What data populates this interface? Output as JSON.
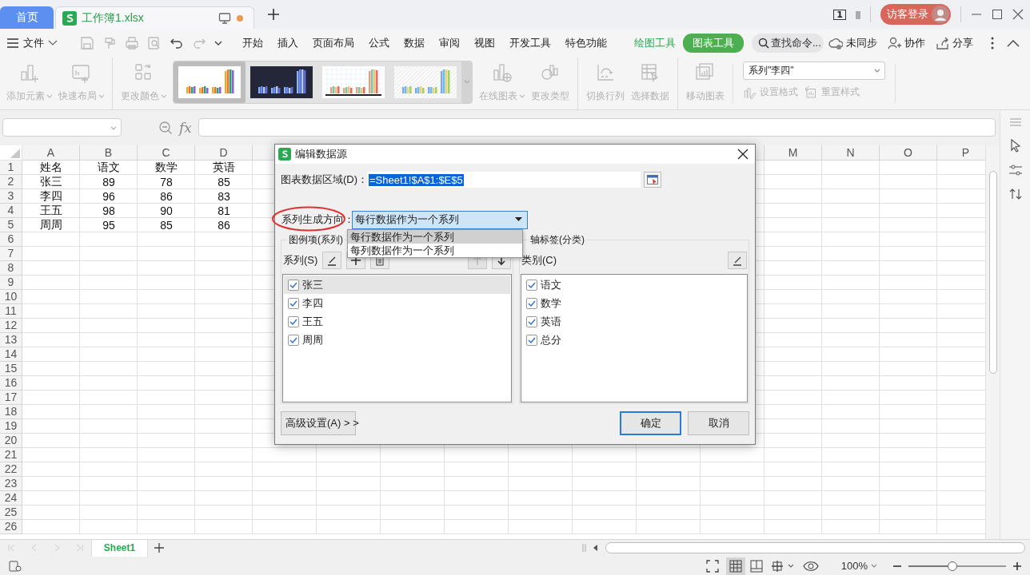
{
  "tabs": [
    {
      "label": "首页",
      "selected": false,
      "kind": "home"
    },
    {
      "label": "工作簿1.xlsx",
      "selected": true,
      "kind": "file",
      "unsaved": true
    }
  ],
  "tile_badge": "1",
  "account": {
    "label": "访客登录"
  },
  "menu": {
    "file": "文件",
    "items": [
      {
        "label": "开始",
        "kind": "main",
        "selected": false
      },
      {
        "label": "插入",
        "kind": "main",
        "selected": false
      },
      {
        "label": "页面布局",
        "kind": "main",
        "selected": false
      },
      {
        "label": "公式",
        "kind": "main",
        "selected": false
      },
      {
        "label": "数据",
        "kind": "main",
        "selected": false
      },
      {
        "label": "审阅",
        "kind": "main",
        "selected": false
      },
      {
        "label": "视图",
        "kind": "main",
        "selected": false
      },
      {
        "label": "开发工具",
        "kind": "main",
        "selected": false
      },
      {
        "label": "特色功能",
        "kind": "main",
        "selected": false
      },
      {
        "label": "绘图工具",
        "kind": "context",
        "selected": false
      },
      {
        "label": "图表工具",
        "kind": "context",
        "selected": true
      }
    ],
    "search_placeholder": "查找命令...",
    "actions": [
      {
        "label": "未同步",
        "kind": "sync"
      },
      {
        "label": "协作",
        "kind": "collab"
      },
      {
        "label": "分享",
        "kind": "share"
      }
    ]
  },
  "ribbon": {
    "tools_before": [
      {
        "label": "添加元素",
        "kind": "add",
        "dropdown": true,
        "disabled": true,
        "separator_before": false
      },
      {
        "label": "快速布局",
        "kind": "layout",
        "dropdown": true,
        "disabled": true,
        "separator_before": false
      },
      {
        "label": "更改颜色",
        "kind": "color",
        "dropdown": true,
        "disabled": true,
        "separator_before": true
      }
    ],
    "styles": [
      {
        "kind": "light",
        "selected": true
      },
      {
        "kind": "dark",
        "selected": false
      },
      {
        "kind": "grid",
        "selected": false
      },
      {
        "kind": "hatched",
        "selected": false
      }
    ],
    "tools_after": [
      {
        "label": "在线图表",
        "kind": "online",
        "dropdown": true,
        "disabled": true,
        "separator_before": false
      },
      {
        "label": "更改类型",
        "kind": "type",
        "dropdown": false,
        "disabled": true,
        "separator_before": false
      },
      {
        "label": "切换行列",
        "kind": "swap",
        "dropdown": false,
        "disabled": true,
        "separator_before": true
      },
      {
        "label": "选择数据",
        "kind": "select",
        "dropdown": false,
        "disabled": true,
        "separator_before": false
      },
      {
        "label": "移动图表",
        "kind": "move",
        "dropdown": false,
        "disabled": true,
        "separator_before": true
      }
    ],
    "series_select": "系列\"李四\"",
    "format_buttons": [
      {
        "label": "设置格式",
        "kind": "format",
        "disabled": true
      },
      {
        "label": "重置样式",
        "kind": "reset",
        "disabled": true
      }
    ]
  },
  "formula_bar": {
    "function_button": "fx"
  },
  "sheet": {
    "columns_left": [
      "A",
      "B",
      "C",
      "D"
    ],
    "columns_right": [
      "M",
      "N",
      "O",
      "P"
    ],
    "rows": [
      {
        "number": "1",
        "cells": [
          "姓名",
          "语文",
          "数学",
          "英语"
        ]
      },
      {
        "number": "2",
        "cells": [
          "张三",
          "89",
          "78",
          "85"
        ]
      },
      {
        "number": "3",
        "cells": [
          "李四",
          "96",
          "86",
          "83"
        ]
      },
      {
        "number": "4",
        "cells": [
          "王五",
          "98",
          "90",
          "81"
        ]
      },
      {
        "number": "5",
        "cells": [
          "周周",
          "95",
          "85",
          "86"
        ]
      },
      {
        "number": "6"
      },
      {
        "number": "7"
      },
      {
        "number": "8"
      },
      {
        "number": "9"
      },
      {
        "number": "10"
      },
      {
        "number": "11"
      },
      {
        "number": "12"
      },
      {
        "number": "13"
      },
      {
        "number": "14"
      },
      {
        "number": "15"
      },
      {
        "number": "16"
      },
      {
        "number": "17"
      },
      {
        "number": "18"
      },
      {
        "number": "19"
      },
      {
        "number": "20"
      },
      {
        "number": "21"
      },
      {
        "number": "22"
      },
      {
        "number": "23"
      },
      {
        "number": "24"
      },
      {
        "number": "25"
      },
      {
        "number": "26"
      }
    ]
  },
  "dialog": {
    "title": "编辑数据源",
    "range_label": "图表数据区域(D)：",
    "range_value": "=Sheet1!$A$1:$E$5",
    "direction_label": "系列生成方向：",
    "direction_circled": true,
    "direction_value": "每行数据作为一个系列",
    "direction_open": true,
    "direction_options": [
      {
        "label": "每行数据作为一个系列",
        "selected": true
      },
      {
        "label": "每列数据作为一个系列",
        "selected": false
      }
    ],
    "series_group": "图例项(系列)",
    "series_label": "系列(S)",
    "series_tools": [
      {
        "kind": "edit",
        "disabled": false
      },
      {
        "kind": "add",
        "disabled": false
      },
      {
        "kind": "delete",
        "disabled": false
      },
      {
        "kind": "up",
        "disabled": true
      },
      {
        "kind": "down",
        "disabled": false
      }
    ],
    "series": [
      {
        "label": "张三",
        "checked": true,
        "selected": true
      },
      {
        "label": "李四",
        "checked": true,
        "selected": false
      },
      {
        "label": "王五",
        "checked": true,
        "selected": false
      },
      {
        "label": "周周",
        "checked": true,
        "selected": false
      }
    ],
    "category_group": "轴标签(分类)",
    "category_label": "类别(C)",
    "categories": [
      {
        "label": "语文",
        "checked": true
      },
      {
        "label": "数学",
        "checked": true
      },
      {
        "label": "英语",
        "checked": true
      },
      {
        "label": "总分",
        "checked": true
      }
    ],
    "advanced": "高级设置(A) > >",
    "buttons": [
      {
        "label": "确定",
        "default": true
      },
      {
        "label": "取消",
        "default": false
      }
    ]
  },
  "sheet_tabs": [
    {
      "label": "Sheet1",
      "selected": true
    }
  ],
  "status": {
    "views": [
      {
        "kind": "normal",
        "selected": true
      },
      {
        "kind": "page",
        "selected": false
      },
      {
        "kind": "break",
        "selected": false
      }
    ],
    "zoom": "100%",
    "zoom_slider": {
      "level": 0.45
    }
  }
}
